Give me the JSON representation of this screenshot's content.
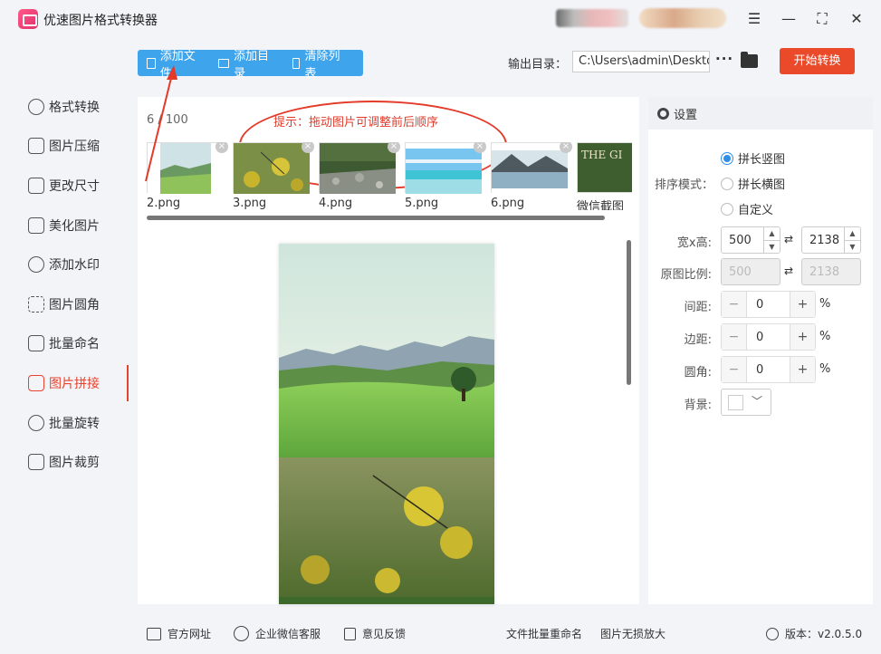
{
  "app": {
    "title": "优速图片格式转换器"
  },
  "sidebar": {
    "items": [
      {
        "label": "格式转换",
        "icon": "format-convert-icon"
      },
      {
        "label": "图片压缩",
        "icon": "compress-icon"
      },
      {
        "label": "更改尺寸",
        "icon": "resize-icon"
      },
      {
        "label": "美化图片",
        "icon": "beautify-icon"
      },
      {
        "label": "添加水印",
        "icon": "watermark-icon"
      },
      {
        "label": "图片圆角",
        "icon": "round-corner-icon"
      },
      {
        "label": "批量命名",
        "icon": "rename-icon"
      },
      {
        "label": "图片拼接",
        "icon": "stitch-icon",
        "active": true
      },
      {
        "label": "批量旋转",
        "icon": "rotate-icon"
      },
      {
        "label": "图片裁剪",
        "icon": "crop-icon"
      }
    ]
  },
  "toolbar": {
    "add_file": "添加文件",
    "add_folder": "添加目录",
    "clear_list": "清除列表",
    "output_label": "输出目录：",
    "output_path": "C:\\Users\\admin\\Deskto",
    "more": "···",
    "start": "开始转换"
  },
  "main": {
    "count": "6 / 100",
    "hint": "提示：拖动图片可调整前后顺序",
    "thumbnails": [
      {
        "name": "2.png",
        "kind": "meadow"
      },
      {
        "name": "3.png",
        "kind": "flowers"
      },
      {
        "name": "4.png",
        "kind": "river"
      },
      {
        "name": "5.png",
        "kind": "beach"
      },
      {
        "name": "6.png",
        "kind": "lake"
      },
      {
        "name": "微信截图_",
        "kind": "cover",
        "cover_text": "THE GI"
      }
    ],
    "close_symbol": "×"
  },
  "settings": {
    "title": "设置",
    "sort_mode_label": "排序模式：",
    "sort_options": [
      "拼长竖图",
      "拼长横图",
      "自定义"
    ],
    "sort_selected": 0,
    "size_label": "宽x高:",
    "width": "500",
    "height": "2138",
    "ratio_label": "原图比例:",
    "ratio_width": "500",
    "ratio_height": "2138",
    "spacing_label": "间距:",
    "spacing": "0",
    "margin_label": "边距:",
    "margin": "0",
    "corner_label": "圆角:",
    "corner": "0",
    "percent": "%",
    "background_label": "背景:",
    "background_color": "#ffffff"
  },
  "bottom": {
    "website": "官方网址",
    "wechat_service": "企业微信客服",
    "feedback": "意见反馈",
    "batch_rename": "文件批量重命名",
    "lossless_enlarge": "图片无损放大",
    "version": "版本：v2.0.5.0"
  },
  "colors": {
    "accent": "#e8412c",
    "toolbar_blue": "#3ea4ec",
    "radio_blue": "#2f8ee8"
  }
}
